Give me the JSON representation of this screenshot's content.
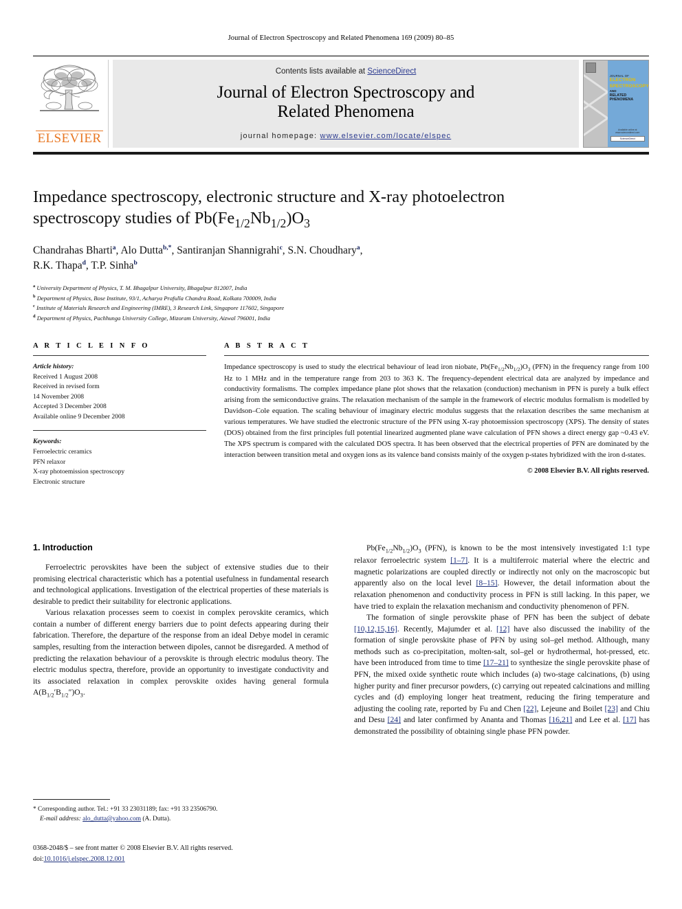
{
  "running_head": "Journal of Electron Spectroscopy and Related Phenomena 169 (2009) 80–85",
  "masthead": {
    "publisher_name": "ELSEVIER",
    "contents_prefix": "Contents lists available at ",
    "sciencedirect": "ScienceDirect",
    "journal_title_line1": "Journal of Electron Spectroscopy and",
    "journal_title_line2": "Related Phenomena",
    "homepage_label": "journal homepage:",
    "homepage_url": "www.elsevier.com/locate/elspec",
    "cover": {
      "l1": "JOURNAL OF",
      "l2": "ELECTRON",
      "l3": "SPECTROSCOPY",
      "l4": "AND",
      "l5": "RELATED PHENOMENA",
      "foot1": "Available online at www.sciencedirect.com",
      "foot2": "ScienceDirect"
    },
    "accent_orange": "#e87722",
    "accent_blue": "#2b3a8f",
    "band_gray": "#e9e9e9"
  },
  "title": {
    "line1": "Impedance spectroscopy, electronic structure and X-ray photoelectron",
    "line2_pre": "spectroscopy studies of Pb(Fe",
    "sub1": "1/2",
    "line2_mid": "Nb",
    "sub2": "1/2",
    "line2_post": ")O",
    "sub3": "3"
  },
  "authors": [
    {
      "name": "Chandrahas Bharti",
      "marks": "a",
      "sep": ", "
    },
    {
      "name": "Alo Dutta",
      "marks": "b,*",
      "sep": ", "
    },
    {
      "name": "Santiranjan Shannigrahi",
      "marks": "c",
      "sep": ", "
    },
    {
      "name": "S.N. Choudhary",
      "marks": "a",
      "sep": ","
    },
    {
      "name": "R.K. Thapa",
      "marks": "d",
      "sep": ", "
    },
    {
      "name": "T.P. Sinha",
      "marks": "b",
      "sep": ""
    }
  ],
  "affiliations": [
    {
      "mark": "a",
      "text": "University Department of Physics, T. M. Bhagalpur University, Bhagalpur 812007, India"
    },
    {
      "mark": "b",
      "text": "Department of Physics, Bose Institute, 93/1, Acharya Prafulla Chandra Road, Kolkata 700009, India"
    },
    {
      "mark": "c",
      "text": "Institute of Materials Research and Engineering (IMRE), 3 Research Link, Singapore 117602, Singapore"
    },
    {
      "mark": "d",
      "text": "Department of Physics, Pachhunga University College, Mizoram University, Aizwal 796001, India"
    }
  ],
  "article_info": {
    "heading": "A R T I C L E    I N F O",
    "history_label": "Article history:",
    "history": [
      "Received 1 August 2008",
      "Received in revised form",
      "14 November 2008",
      "Accepted 3 December 2008",
      "Available online 9 December 2008"
    ],
    "keywords_label": "Keywords:",
    "keywords": [
      "Ferroelectric ceramics",
      "PFN relaxor",
      "X-ray photoemission spectroscopy",
      "Electronic structure"
    ]
  },
  "abstract": {
    "heading": "A B S T R A C T",
    "text_p1": "Impedance spectroscopy is used to study the electrical behaviour of lead iron niobate, Pb(Fe",
    "text_p1_sub1": "1/2",
    "text_p1_mid": "Nb",
    "text_p1_sub2": "1/2",
    "text_p1_post": ")O",
    "text_p1_sub3": "3",
    "text_rest": " (PFN) in the frequency range from 100 Hz to 1 MHz and in the temperature range from 203 to 363 K. The frequency-dependent electrical data are analyzed by impedance and conductivity formalisms. The complex impedance plane plot shows that the relaxation (conduction) mechanism in PFN is purely a bulk effect arising from the semiconductive grains. The relaxation mechanism of the sample in the framework of electric modulus formalism is modelled by Davidson–Cole equation. The scaling behaviour of imaginary electric modulus suggests that the relaxation describes the same mechanism at various temperatures. We have studied the electronic structure of the PFN using X-ray photoemission spectroscopy (XPS). The density of states (DOS) obtained from the first principles full potential linearized augmented plane wave calculation of PFN shows a direct energy gap ~0.43 eV. The XPS spectrum is compared with the calculated DOS spectra. It has been observed that the electrical properties of PFN are dominated by the interaction between transition metal and oxygen ions as its valence band consists mainly of the oxygen p-states hybridized with the iron d-states.",
    "copyright": "© 2008 Elsevier B.V. All rights reserved."
  },
  "body": {
    "section_number_title": "1.  Introduction",
    "left_p1": "Ferroelectric perovskites have been the subject of extensive studies due to their promising electrical characteristic which has a potential usefulness in fundamental research and technological applications. Investigation of the electrical properties of these materials is desirable to predict their suitability for electronic applications.",
    "left_p2_a": "Various relaxation processes seem to coexist in complex perovskite ceramics, which contain a number of different energy barriers due to point defects appearing during their fabrication. Therefore, the departure of the response from an ideal Debye model in ceramic samples, resulting from the interaction between dipoles, cannot be disregarded. A method of predicting the relaxation behaviour of a perovskite is through electric modulus theory. The electric modulus spectra, therefore, provide an opportunity to investigate conductivity and its associated relaxation in complex perovskite oxides having general formula A(B",
    "left_p2_sub1": "1/2",
    "left_p2_b": "′B",
    "left_p2_sub2": "1/2",
    "left_p2_c": "″)O",
    "left_p2_sub3": "3",
    "left_p2_d": ".",
    "right_p1_a": "Pb(Fe",
    "right_p1_sub1": "1/2",
    "right_p1_b": "Nb",
    "right_p1_sub2": "1/2",
    "right_p1_c": ")O",
    "right_p1_sub3": "3",
    "right_p1_d": " (PFN), is known to be the most intensively investigated 1:1 type relaxor ferroelectric system ",
    "right_p1_ref1": "[1–7]",
    "right_p1_e": ". It is a multiferroic material where the electric and magnetic polarizations are coupled directly or indirectly not only on the macroscopic but apparently also on the local level ",
    "right_p1_ref2": "[8–15]",
    "right_p1_f": ". However, the detail information about the relaxation phenomenon and conductivity process in PFN is still lacking. In this paper, we have tried to explain the relaxation mechanism and conductivity phenomenon of PFN.",
    "right_p2_a": "The formation of single perovskite phase of PFN has been the subject of debate ",
    "right_p2_ref1": "[10,12,15,16]",
    "right_p2_b": ". Recently, Majumder et al. ",
    "right_p2_ref2": "[12]",
    "right_p2_c": " have also discussed the inability of the formation of single perovskite phase of PFN by using sol–gel method. Although, many methods such as co-precipitation, molten-salt, sol–gel or hydrothermal, hot-pressed, etc. have been introduced from time to time ",
    "right_p2_ref3": "[17–21]",
    "right_p2_d": " to synthesize the single perovskite phase of PFN, the mixed oxide synthetic route which includes (a) two-stage calcinations, (b) using higher purity and finer precursor powders, (c) carrying out repeated calcinations and milling cycles and (d) employing longer heat treatment, reducing the firing temperature and adjusting the cooling rate, reported by Fu and Chen ",
    "right_p2_ref4": "[22]",
    "right_p2_e": ", Lejeune and Boilet ",
    "right_p2_ref5": "[23]",
    "right_p2_f": " and Chiu and Desu ",
    "right_p2_ref6": "[24]",
    "right_p2_g": " and later confirmed by Ananta and Thomas ",
    "right_p2_ref7": "[16,21]",
    "right_p2_h": " and Lee et al. ",
    "right_p2_ref8": "[17]",
    "right_p2_i": " has demonstrated the possibility of obtaining single phase PFN powder."
  },
  "footnote": {
    "marker": "*",
    "corresponding": "Corresponding author. Tel.: +91 33 23031189; fax: +91 33 23506790.",
    "email_label": "E-mail address:",
    "email": "alo_dutta@yahoo.com",
    "email_suffix": "(A. Dutta)."
  },
  "imprint": {
    "line1": "0368-2048/$ – see front matter © 2008 Elsevier B.V. All rights reserved.",
    "doi_label": "doi:",
    "doi_value": "10.1016/j.elspec.2008.12.001"
  }
}
